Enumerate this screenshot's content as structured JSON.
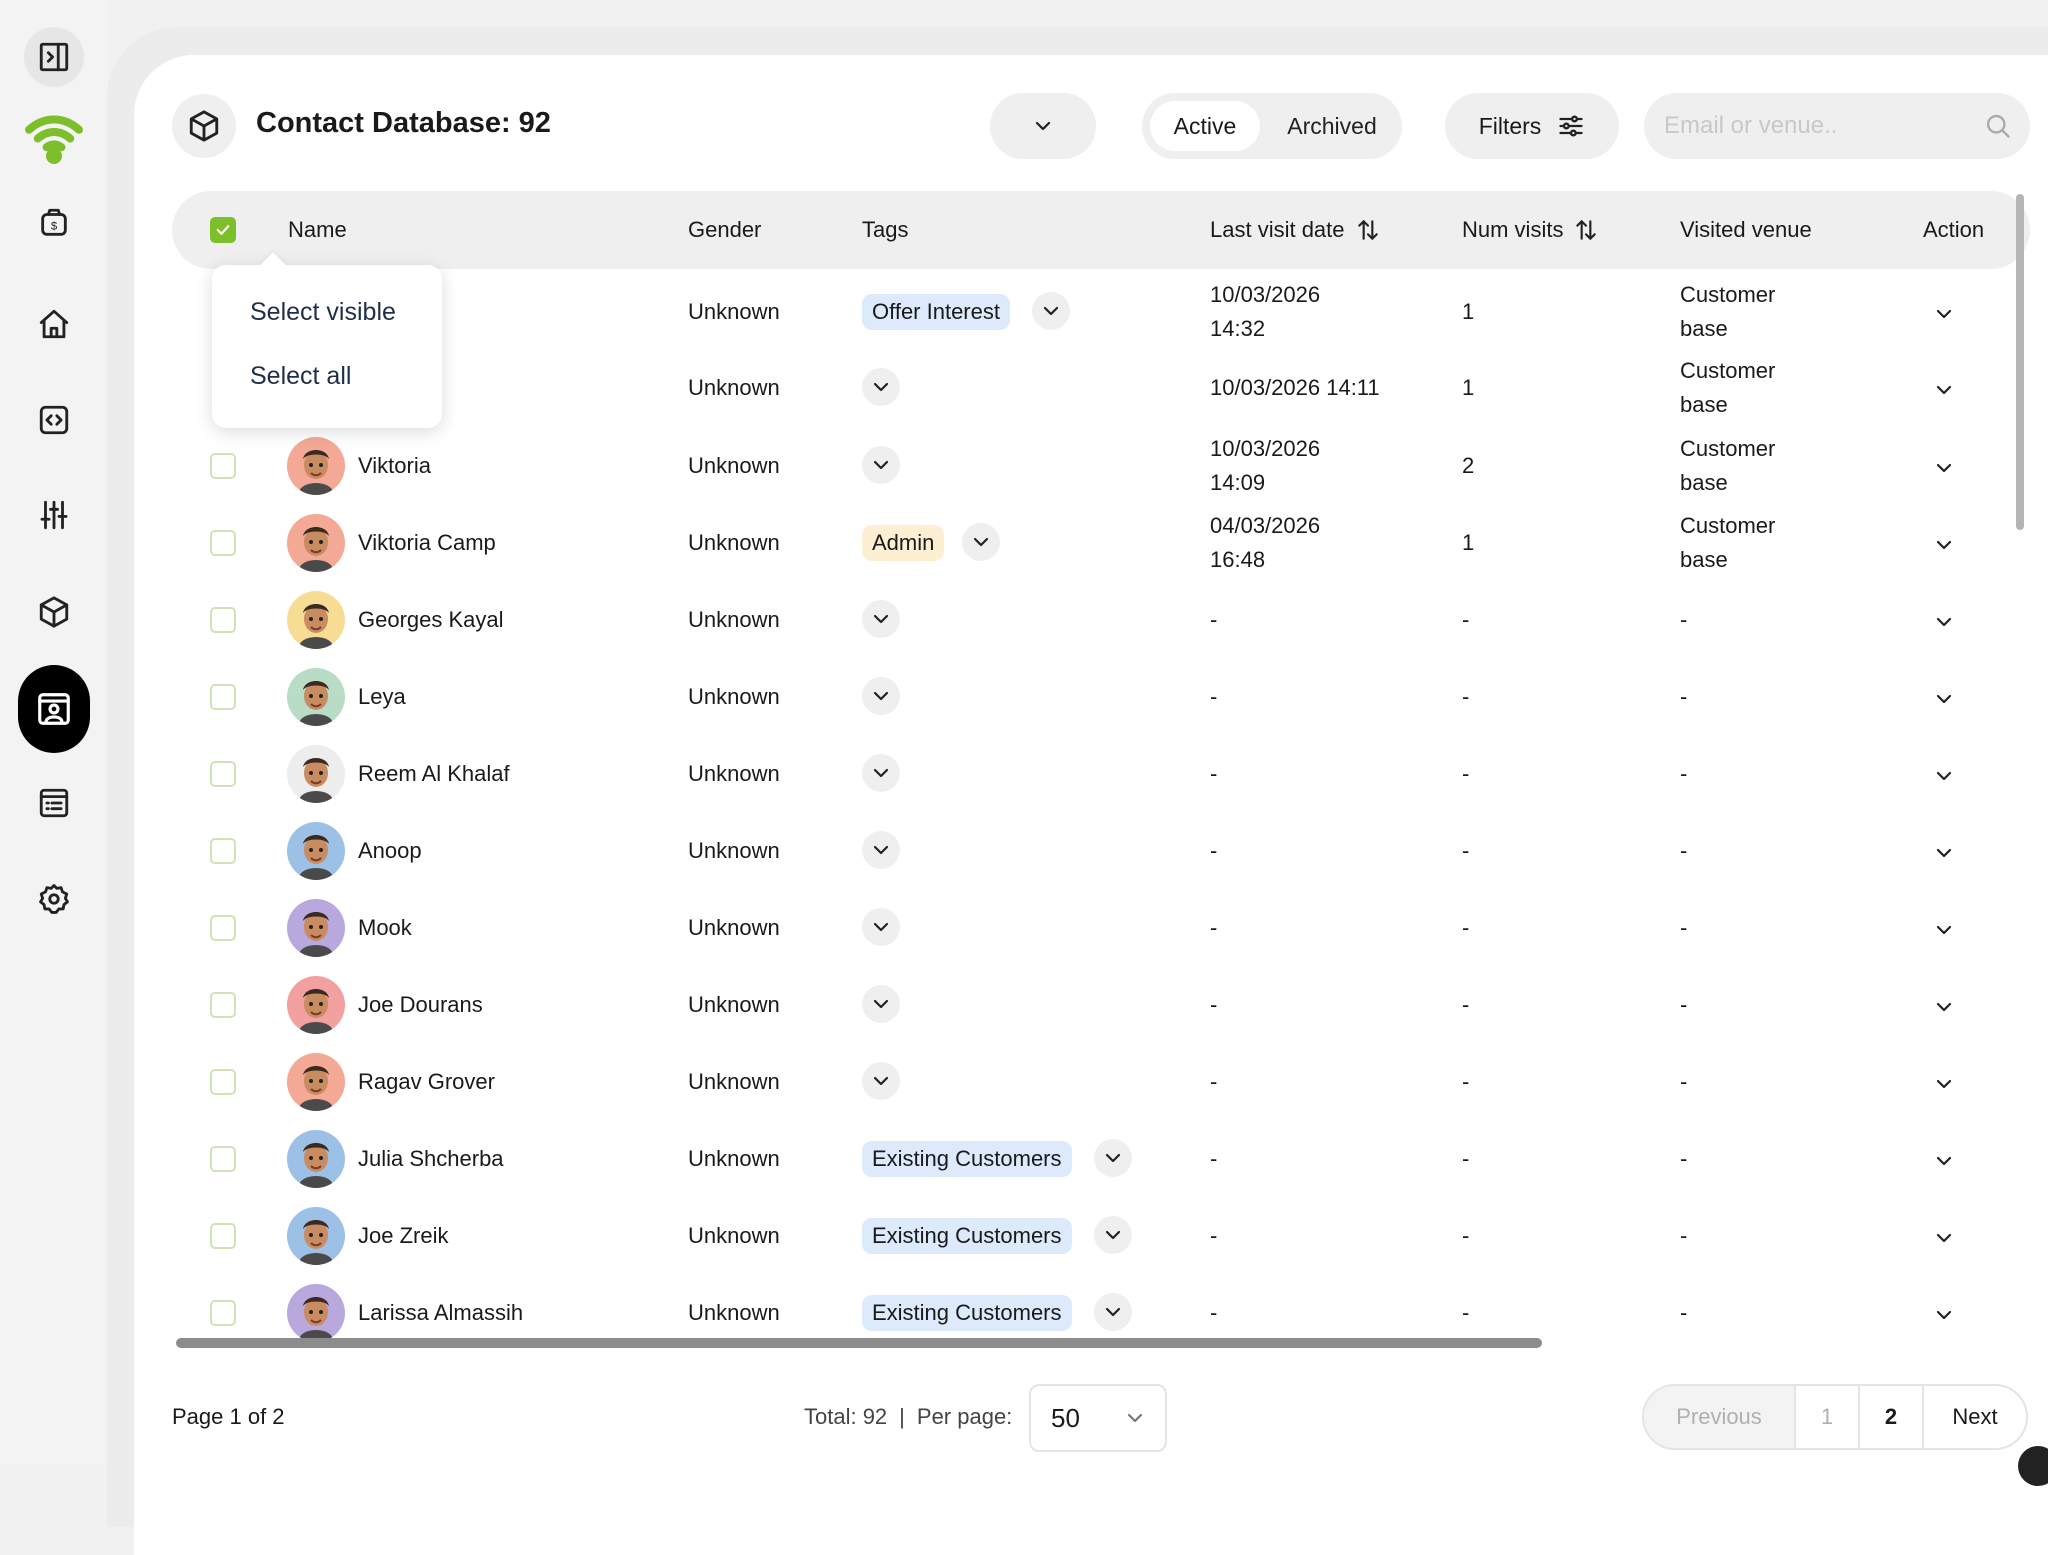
{
  "header": {
    "title": "Contact Database: 92",
    "tabs": [
      "Active",
      "Archived"
    ],
    "filters_label": "Filters",
    "search_placeholder": "Email or venue.."
  },
  "columns": {
    "name": "Name",
    "gender": "Gender",
    "tags": "Tags",
    "last_visit": "Last visit date",
    "num_visits": "Num visits",
    "visited_venue": "Visited venue",
    "action": "Action"
  },
  "select_popup": {
    "select_visible": "Select visible",
    "select_all": "Select all"
  },
  "rows": [
    {
      "name": "",
      "gender": "Unknown",
      "tag": "Offer Interest",
      "tag_color": "blue",
      "last_visit_1": "10/03/2026",
      "last_visit_2": "14:32",
      "num_visits": "1",
      "venue_1": "Customer",
      "venue_2": "base"
    },
    {
      "name": "",
      "gender": "Unknown",
      "tag": "",
      "tag_color": "",
      "last_visit_1": "10/03/2026 14:11",
      "last_visit_2": "",
      "num_visits": "1",
      "venue_1": "Customer",
      "venue_2": "base"
    },
    {
      "name": "Viktoria",
      "gender": "Unknown",
      "tag": "",
      "tag_color": "",
      "last_visit_1": "10/03/2026",
      "last_visit_2": "14:09",
      "num_visits": "2",
      "venue_1": "Customer",
      "venue_2": "base",
      "avatar": "#f4a896"
    },
    {
      "name": "Viktoria Camp",
      "gender": "Unknown",
      "tag": "Admin",
      "tag_color": "yellow",
      "last_visit_1": "04/03/2026",
      "last_visit_2": "16:48",
      "num_visits": "1",
      "venue_1": "Customer",
      "venue_2": "base",
      "avatar": "#f4a896"
    },
    {
      "name": "Georges Kayal",
      "gender": "Unknown",
      "tag": "",
      "tag_color": "",
      "last_visit_1": "-",
      "last_visit_2": "",
      "num_visits": "-",
      "venue_1": "-",
      "venue_2": "",
      "avatar": "#f7dd94"
    },
    {
      "name": "Leya",
      "gender": "Unknown",
      "tag": "",
      "tag_color": "",
      "last_visit_1": "-",
      "last_visit_2": "",
      "num_visits": "-",
      "venue_1": "-",
      "venue_2": "",
      "avatar": "#b9dcc6"
    },
    {
      "name": "Reem Al Khalaf",
      "gender": "Unknown",
      "tag": "",
      "tag_color": "",
      "last_visit_1": "-",
      "last_visit_2": "",
      "num_visits": "-",
      "venue_1": "-",
      "venue_2": "",
      "avatar": "#ededed"
    },
    {
      "name": "Anoop",
      "gender": "Unknown",
      "tag": "",
      "tag_color": "",
      "last_visit_1": "-",
      "last_visit_2": "",
      "num_visits": "-",
      "venue_1": "-",
      "venue_2": "",
      "avatar": "#9cc0e6"
    },
    {
      "name": "Mook",
      "gender": "Unknown",
      "tag": "",
      "tag_color": "",
      "last_visit_1": "-",
      "last_visit_2": "",
      "num_visits": "-",
      "venue_1": "-",
      "venue_2": "",
      "avatar": "#b8a8de"
    },
    {
      "name": "Joe Dourans",
      "gender": "Unknown",
      "tag": "",
      "tag_color": "",
      "last_visit_1": "-",
      "last_visit_2": "",
      "num_visits": "-",
      "venue_1": "-",
      "venue_2": "",
      "avatar": "#f2a0a0"
    },
    {
      "name": "Ragav Grover",
      "gender": "Unknown",
      "tag": "",
      "tag_color": "",
      "last_visit_1": "-",
      "last_visit_2": "",
      "num_visits": "-",
      "venue_1": "-",
      "venue_2": "",
      "avatar": "#f4a896"
    },
    {
      "name": "Julia Shcherba",
      "gender": "Unknown",
      "tag": "Existing Customers",
      "tag_color": "blue",
      "last_visit_1": "-",
      "last_visit_2": "",
      "num_visits": "-",
      "venue_1": "-",
      "venue_2": "",
      "avatar": "#9cc0e6"
    },
    {
      "name": "Joe Zreik",
      "gender": "Unknown",
      "tag": "Existing Customers",
      "tag_color": "blue",
      "last_visit_1": "-",
      "last_visit_2": "",
      "num_visits": "-",
      "venue_1": "-",
      "venue_2": "",
      "avatar": "#9cc0e6"
    },
    {
      "name": "Larissa Almassih",
      "gender": "Unknown",
      "tag": "Existing Customers",
      "tag_color": "blue",
      "last_visit_1": "-",
      "last_visit_2": "",
      "num_visits": "-",
      "venue_1": "-",
      "venue_2": "",
      "avatar": "#b8a8de"
    }
  ],
  "footer": {
    "page_info": "Page 1 of 2",
    "total": "Total: 92",
    "separator": "|",
    "per_page_label": "Per page:",
    "per_page_value": "50",
    "previous": "Previous",
    "page_1": "1",
    "page_2": "2",
    "next": "Next"
  },
  "colors": {
    "accent_green": "#7cbf2b",
    "tag_blue": "#dceafb",
    "tag_yellow": "#fcefd2"
  },
  "icons": {
    "sidebar": [
      "sidebar-toggle-icon",
      "wifi-icon",
      "money-bag-icon",
      "home-icon",
      "code-icon",
      "sliders-icon",
      "cube-icon",
      "contacts-icon",
      "list-icon",
      "gear-icon"
    ]
  }
}
